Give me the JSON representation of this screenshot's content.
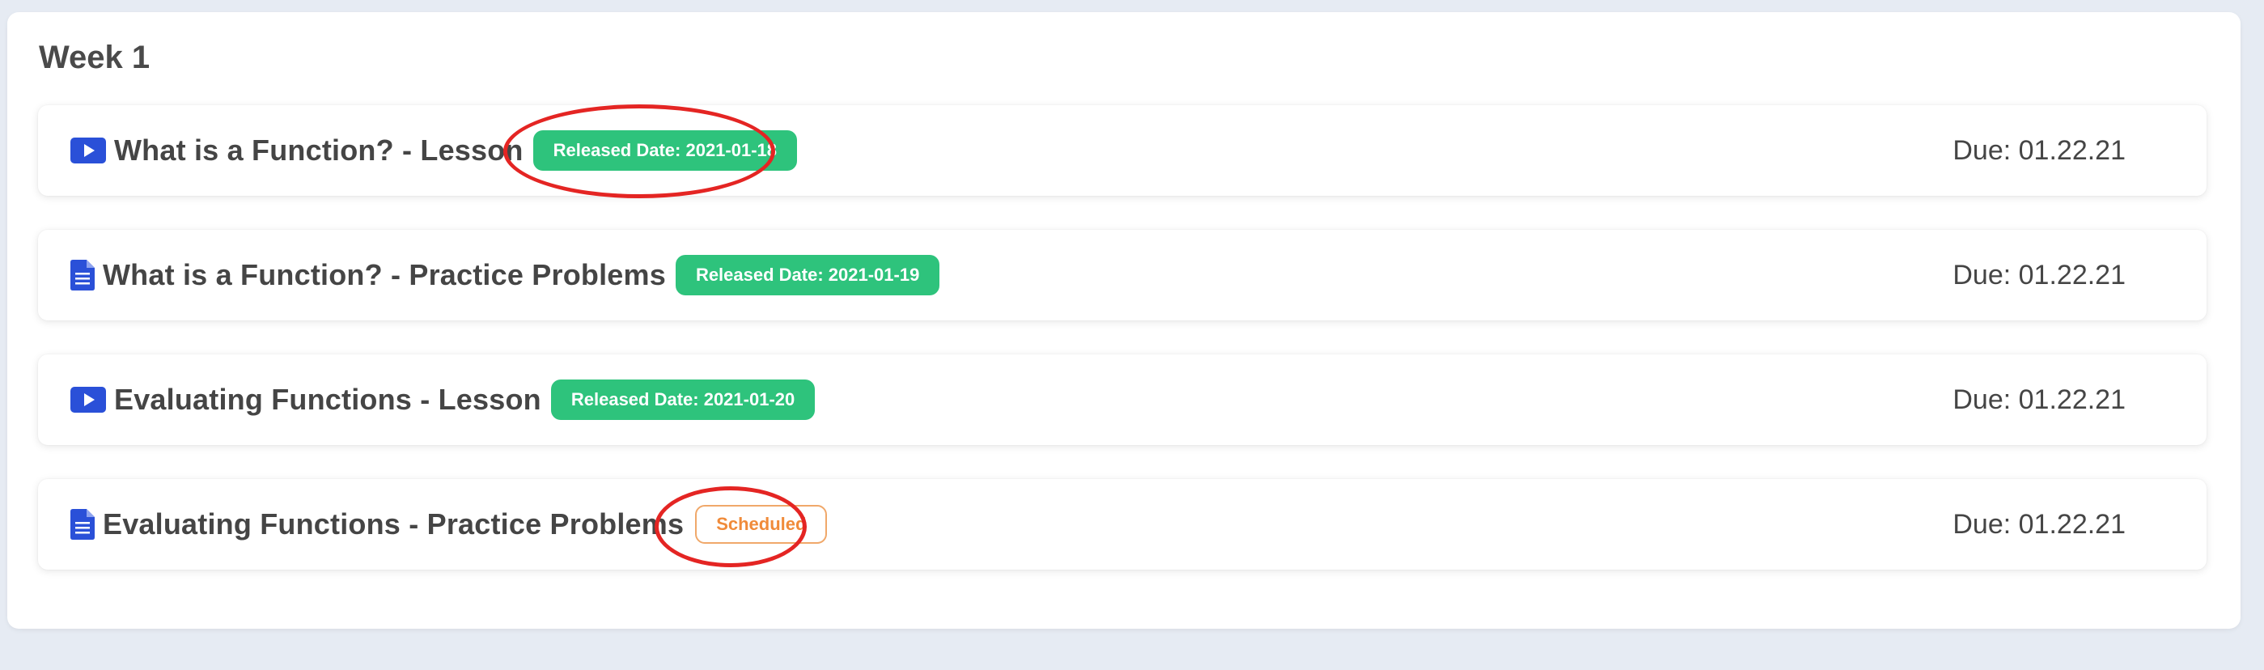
{
  "week": {
    "title": "Week 1"
  },
  "items": [
    {
      "icon": "video-play-icon",
      "title": "What is a Function? - Lesson",
      "badge": "Released Date: 2021-01-18",
      "badge_type": "released",
      "due": "Due: 01.22.21",
      "highlighted": true
    },
    {
      "icon": "document-icon",
      "title": "What is a Function? - Practice Problems",
      "badge": "Released Date: 2021-01-19",
      "badge_type": "released",
      "due": "Due: 01.22.21",
      "highlighted": false
    },
    {
      "icon": "video-play-icon",
      "title": "Evaluating Functions - Lesson",
      "badge": "Released Date: 2021-01-20",
      "badge_type": "released",
      "due": "Due: 01.22.21",
      "highlighted": false
    },
    {
      "icon": "document-icon",
      "title": "Evaluating Functions - Practice Problems",
      "badge": "Scheduled",
      "badge_type": "scheduled",
      "due": "Due: 01.22.21",
      "highlighted": true
    }
  ],
  "colors": {
    "page_background": "#e6ebf3",
    "icon_blue": "#2a50d8",
    "released_green": "#2ec37c",
    "scheduled_orange": "#f08b3a",
    "annotation_red": "#e42523"
  }
}
